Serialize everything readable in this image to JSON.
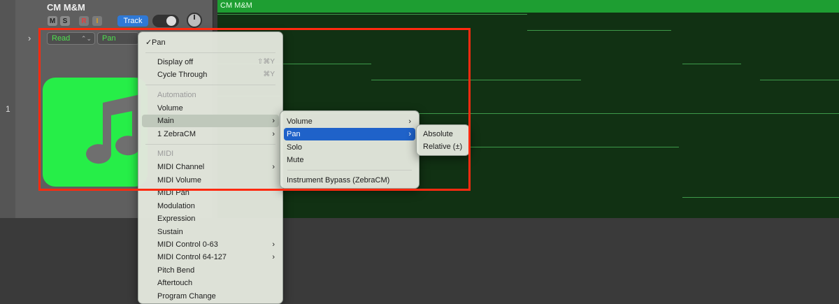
{
  "track": {
    "number": "1",
    "name": "CM M&M",
    "buttons": {
      "mute": "M",
      "solo": "S",
      "record": "R",
      "input": "I"
    },
    "track_button": "Track",
    "automation_mode": "Read",
    "automation_param": "Pan"
  },
  "region": {
    "name": "CM M&M"
  },
  "menu": {
    "checked_item": "Pan",
    "display_off": "Display off",
    "display_off_shortcut": "⇧⌘Y",
    "cycle_through": "Cycle Through",
    "cycle_through_shortcut": "⌘Y",
    "automation_header": "Automation",
    "volume": "Volume",
    "main": "Main",
    "zebra": "1 ZebraCM",
    "midi_header": "MIDI",
    "midi_channel": "MIDI Channel",
    "midi_volume": "MIDI Volume",
    "midi_pan": "MIDI Pan",
    "modulation": "Modulation",
    "expression": "Expression",
    "sustain": "Sustain",
    "midi_control_0_63": "MIDI Control 0-63",
    "midi_control_64_127": "MIDI Control 64-127",
    "pitch_bend": "Pitch Bend",
    "aftertouch": "Aftertouch",
    "program_change": "Program Change"
  },
  "submenu_main": {
    "volume": "Volume",
    "pan": "Pan",
    "solo": "Solo",
    "mute": "Mute",
    "instrument_bypass": "Instrument Bypass (ZebraCM)"
  },
  "submenu_pan": {
    "absolute": "Absolute",
    "relative": "Relative (±)"
  },
  "colors": {
    "region_green": "#1e9e32",
    "highlight_red": "#ff2a10",
    "selection_blue": "#1f62c9",
    "track_icon_green": "#26ee48"
  },
  "icons": {
    "track_icon": "music-note-icon",
    "submenu_arrow": "chevron-right-icon",
    "checkmark": "checkmark-icon"
  }
}
